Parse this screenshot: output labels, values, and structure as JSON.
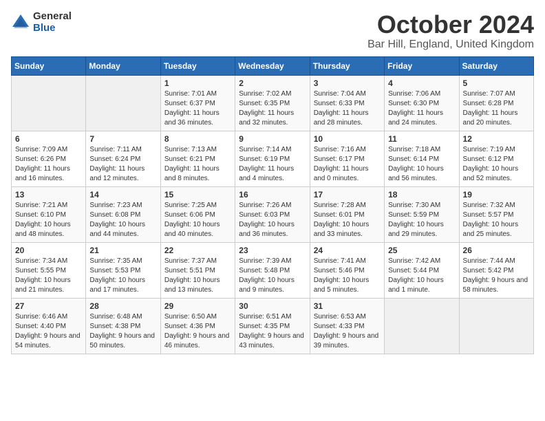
{
  "logo": {
    "general": "General",
    "blue": "Blue"
  },
  "title": "October 2024",
  "location": "Bar Hill, England, United Kingdom",
  "days_header": [
    "Sunday",
    "Monday",
    "Tuesday",
    "Wednesday",
    "Thursday",
    "Friday",
    "Saturday"
  ],
  "weeks": [
    [
      {
        "day": "",
        "empty": true
      },
      {
        "day": "",
        "empty": true
      },
      {
        "day": "1",
        "sunrise": "Sunrise: 7:01 AM",
        "sunset": "Sunset: 6:37 PM",
        "daylight": "Daylight: 11 hours and 36 minutes."
      },
      {
        "day": "2",
        "sunrise": "Sunrise: 7:02 AM",
        "sunset": "Sunset: 6:35 PM",
        "daylight": "Daylight: 11 hours and 32 minutes."
      },
      {
        "day": "3",
        "sunrise": "Sunrise: 7:04 AM",
        "sunset": "Sunset: 6:33 PM",
        "daylight": "Daylight: 11 hours and 28 minutes."
      },
      {
        "day": "4",
        "sunrise": "Sunrise: 7:06 AM",
        "sunset": "Sunset: 6:30 PM",
        "daylight": "Daylight: 11 hours and 24 minutes."
      },
      {
        "day": "5",
        "sunrise": "Sunrise: 7:07 AM",
        "sunset": "Sunset: 6:28 PM",
        "daylight": "Daylight: 11 hours and 20 minutes."
      }
    ],
    [
      {
        "day": "6",
        "sunrise": "Sunrise: 7:09 AM",
        "sunset": "Sunset: 6:26 PM",
        "daylight": "Daylight: 11 hours and 16 minutes."
      },
      {
        "day": "7",
        "sunrise": "Sunrise: 7:11 AM",
        "sunset": "Sunset: 6:24 PM",
        "daylight": "Daylight: 11 hours and 12 minutes."
      },
      {
        "day": "8",
        "sunrise": "Sunrise: 7:13 AM",
        "sunset": "Sunset: 6:21 PM",
        "daylight": "Daylight: 11 hours and 8 minutes."
      },
      {
        "day": "9",
        "sunrise": "Sunrise: 7:14 AM",
        "sunset": "Sunset: 6:19 PM",
        "daylight": "Daylight: 11 hours and 4 minutes."
      },
      {
        "day": "10",
        "sunrise": "Sunrise: 7:16 AM",
        "sunset": "Sunset: 6:17 PM",
        "daylight": "Daylight: 11 hours and 0 minutes."
      },
      {
        "day": "11",
        "sunrise": "Sunrise: 7:18 AM",
        "sunset": "Sunset: 6:14 PM",
        "daylight": "Daylight: 10 hours and 56 minutes."
      },
      {
        "day": "12",
        "sunrise": "Sunrise: 7:19 AM",
        "sunset": "Sunset: 6:12 PM",
        "daylight": "Daylight: 10 hours and 52 minutes."
      }
    ],
    [
      {
        "day": "13",
        "sunrise": "Sunrise: 7:21 AM",
        "sunset": "Sunset: 6:10 PM",
        "daylight": "Daylight: 10 hours and 48 minutes."
      },
      {
        "day": "14",
        "sunrise": "Sunrise: 7:23 AM",
        "sunset": "Sunset: 6:08 PM",
        "daylight": "Daylight: 10 hours and 44 minutes."
      },
      {
        "day": "15",
        "sunrise": "Sunrise: 7:25 AM",
        "sunset": "Sunset: 6:06 PM",
        "daylight": "Daylight: 10 hours and 40 minutes."
      },
      {
        "day": "16",
        "sunrise": "Sunrise: 7:26 AM",
        "sunset": "Sunset: 6:03 PM",
        "daylight": "Daylight: 10 hours and 36 minutes."
      },
      {
        "day": "17",
        "sunrise": "Sunrise: 7:28 AM",
        "sunset": "Sunset: 6:01 PM",
        "daylight": "Daylight: 10 hours and 33 minutes."
      },
      {
        "day": "18",
        "sunrise": "Sunrise: 7:30 AM",
        "sunset": "Sunset: 5:59 PM",
        "daylight": "Daylight: 10 hours and 29 minutes."
      },
      {
        "day": "19",
        "sunrise": "Sunrise: 7:32 AM",
        "sunset": "Sunset: 5:57 PM",
        "daylight": "Daylight: 10 hours and 25 minutes."
      }
    ],
    [
      {
        "day": "20",
        "sunrise": "Sunrise: 7:34 AM",
        "sunset": "Sunset: 5:55 PM",
        "daylight": "Daylight: 10 hours and 21 minutes."
      },
      {
        "day": "21",
        "sunrise": "Sunrise: 7:35 AM",
        "sunset": "Sunset: 5:53 PM",
        "daylight": "Daylight: 10 hours and 17 minutes."
      },
      {
        "day": "22",
        "sunrise": "Sunrise: 7:37 AM",
        "sunset": "Sunset: 5:51 PM",
        "daylight": "Daylight: 10 hours and 13 minutes."
      },
      {
        "day": "23",
        "sunrise": "Sunrise: 7:39 AM",
        "sunset": "Sunset: 5:48 PM",
        "daylight": "Daylight: 10 hours and 9 minutes."
      },
      {
        "day": "24",
        "sunrise": "Sunrise: 7:41 AM",
        "sunset": "Sunset: 5:46 PM",
        "daylight": "Daylight: 10 hours and 5 minutes."
      },
      {
        "day": "25",
        "sunrise": "Sunrise: 7:42 AM",
        "sunset": "Sunset: 5:44 PM",
        "daylight": "Daylight: 10 hours and 1 minute."
      },
      {
        "day": "26",
        "sunrise": "Sunrise: 7:44 AM",
        "sunset": "Sunset: 5:42 PM",
        "daylight": "Daylight: 9 hours and 58 minutes."
      }
    ],
    [
      {
        "day": "27",
        "sunrise": "Sunrise: 6:46 AM",
        "sunset": "Sunset: 4:40 PM",
        "daylight": "Daylight: 9 hours and 54 minutes."
      },
      {
        "day": "28",
        "sunrise": "Sunrise: 6:48 AM",
        "sunset": "Sunset: 4:38 PM",
        "daylight": "Daylight: 9 hours and 50 minutes."
      },
      {
        "day": "29",
        "sunrise": "Sunrise: 6:50 AM",
        "sunset": "Sunset: 4:36 PM",
        "daylight": "Daylight: 9 hours and 46 minutes."
      },
      {
        "day": "30",
        "sunrise": "Sunrise: 6:51 AM",
        "sunset": "Sunset: 4:35 PM",
        "daylight": "Daylight: 9 hours and 43 minutes."
      },
      {
        "day": "31",
        "sunrise": "Sunrise: 6:53 AM",
        "sunset": "Sunset: 4:33 PM",
        "daylight": "Daylight: 9 hours and 39 minutes."
      },
      {
        "day": "",
        "empty": true
      },
      {
        "day": "",
        "empty": true
      }
    ]
  ]
}
